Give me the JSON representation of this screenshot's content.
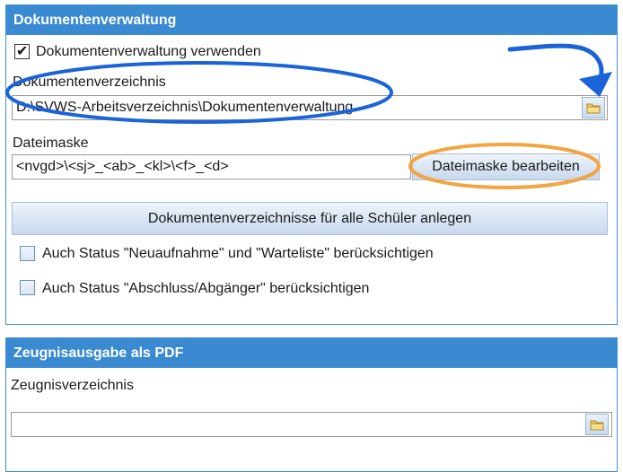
{
  "doc_panel": {
    "title": "Dokumentenverwaltung",
    "use_checkbox_label": "Dokumentenverwaltung verwenden",
    "use_checked": true,
    "dir_label": "Dokumentenverzeichnis",
    "dir_value": "D:\\SVWS-Arbeitsverzeichnis\\Dokumentenverwaltung",
    "mask_label": "Dateimaske",
    "mask_value": "<nvgd>\\<sj>_<ab>_<kl>\\<f>_<d>",
    "edit_mask_button": "Dateimaske bearbeiten",
    "create_dirs_button": "Dokumentenverzeichnisse für alle Schüler anlegen",
    "status_new_label": "Auch Status \"Neuaufnahme\" und \"Warteliste\" berücksichtigen",
    "status_new_checked": false,
    "status_exit_label": "Auch Status \"Abschluss/Abgänger\" berücksichtigen",
    "status_exit_checked": false
  },
  "pdf_panel": {
    "title": "Zeugnisausgabe als PDF",
    "dir_label": "Zeugnisverzeichnis",
    "dir_value": ""
  },
  "icons": {
    "folder": "folder-icon",
    "check": "checkmark-icon"
  },
  "colors": {
    "header_blue": "#3a8ad2",
    "annotation_blue": "#1a63d8",
    "annotation_orange": "#f2a541"
  }
}
